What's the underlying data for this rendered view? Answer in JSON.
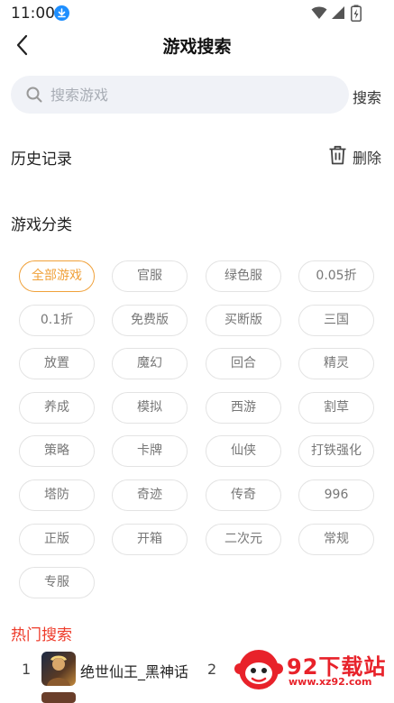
{
  "status_bar": {
    "time": "11:00"
  },
  "header": {
    "title": "游戏搜索"
  },
  "search": {
    "placeholder": "搜索游戏",
    "value": "",
    "button_label": "搜索"
  },
  "history": {
    "title": "历史记录",
    "delete_label": "删除"
  },
  "categories": {
    "title": "游戏分类",
    "selected": "全部游戏",
    "tags": [
      "全部游戏",
      "官服",
      "绿色服",
      "0.05折",
      "0.1折",
      "免费版",
      "买断版",
      "三国",
      "放置",
      "魔幻",
      "回合",
      "精灵",
      "养成",
      "模拟",
      "西游",
      "割草",
      "策略",
      "卡牌",
      "仙侠",
      "打铁强化",
      "塔防",
      "奇迹",
      "传奇",
      "996",
      "正版",
      "开箱",
      "二次元",
      "常规",
      "专服"
    ]
  },
  "hot_search": {
    "title": "热门搜索",
    "items": [
      {
        "rank": "1",
        "name": "绝世仙王_黑神话"
      },
      {
        "rank": "2",
        "name": ""
      }
    ]
  },
  "watermark": {
    "name": "92下载站",
    "url": "www.xz92.com"
  },
  "colors": {
    "accent": "#f0a13a",
    "hot": "#ee3b2a",
    "search_bg": "#f0f2f7",
    "watermark": "#e8222a"
  }
}
